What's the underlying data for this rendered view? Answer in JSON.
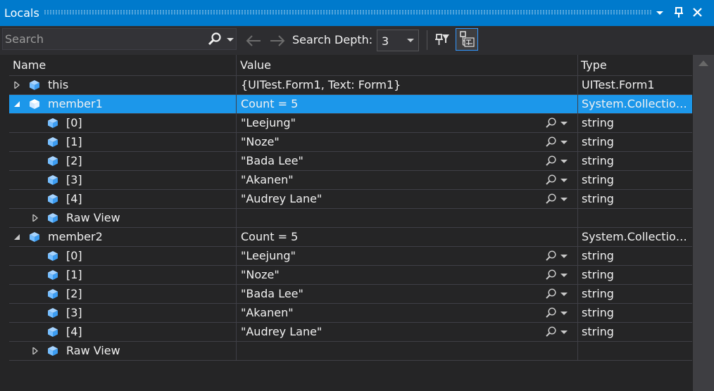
{
  "window": {
    "title": "Locals"
  },
  "toolbar": {
    "search_placeholder": "Search",
    "depth_label": "Search Depth:",
    "depth_value": "3"
  },
  "columns": {
    "name": "Name",
    "value": "Value",
    "type": "Type"
  },
  "rows": [
    {
      "level": 0,
      "expander": "collapsed",
      "icon": "cube",
      "name": "this",
      "value": "{UITest.Form1, Text: Form1}",
      "type": "UITest.Form1",
      "selected": false,
      "magnifier": false
    },
    {
      "level": 0,
      "expander": "expanded",
      "icon": "cube",
      "name": "member1",
      "value": "Count = 5",
      "type": "System.Collection…",
      "selected": true,
      "magnifier": false
    },
    {
      "level": 1,
      "expander": "none",
      "icon": "cube",
      "name": "[0]",
      "value": "\"Leejung\"",
      "type": "string",
      "selected": false,
      "magnifier": true
    },
    {
      "level": 1,
      "expander": "none",
      "icon": "cube",
      "name": "[1]",
      "value": "\"Noze\"",
      "type": "string",
      "selected": false,
      "magnifier": true
    },
    {
      "level": 1,
      "expander": "none",
      "icon": "cube",
      "name": "[2]",
      "value": "\"Bada Lee\"",
      "type": "string",
      "selected": false,
      "magnifier": true
    },
    {
      "level": 1,
      "expander": "none",
      "icon": "cube",
      "name": "[3]",
      "value": "\"Akanen\"",
      "type": "string",
      "selected": false,
      "magnifier": true
    },
    {
      "level": 1,
      "expander": "none",
      "icon": "cube",
      "name": "[4]",
      "value": "\"Audrey Lane\"",
      "type": "string",
      "selected": false,
      "magnifier": true
    },
    {
      "level": 1,
      "expander": "collapsed",
      "icon": "cube",
      "name": "Raw View",
      "value": "",
      "type": "",
      "selected": false,
      "magnifier": false
    },
    {
      "level": 0,
      "expander": "expanded",
      "icon": "cube",
      "name": "member2",
      "value": "Count = 5",
      "type": "System.Collection…",
      "selected": false,
      "magnifier": false
    },
    {
      "level": 1,
      "expander": "none",
      "icon": "cube",
      "name": "[0]",
      "value": "\"Leejung\"",
      "type": "string",
      "selected": false,
      "magnifier": true
    },
    {
      "level": 1,
      "expander": "none",
      "icon": "cube",
      "name": "[1]",
      "value": "\"Noze\"",
      "type": "string",
      "selected": false,
      "magnifier": true
    },
    {
      "level": 1,
      "expander": "none",
      "icon": "cube",
      "name": "[2]",
      "value": "\"Bada Lee\"",
      "type": "string",
      "selected": false,
      "magnifier": true
    },
    {
      "level": 1,
      "expander": "none",
      "icon": "cube",
      "name": "[3]",
      "value": "\"Akanen\"",
      "type": "string",
      "selected": false,
      "magnifier": true
    },
    {
      "level": 1,
      "expander": "none",
      "icon": "cube",
      "name": "[4]",
      "value": "\"Audrey Lane\"",
      "type": "string",
      "selected": false,
      "magnifier": true
    },
    {
      "level": 1,
      "expander": "collapsed",
      "icon": "cube",
      "name": "Raw View",
      "value": "",
      "type": "",
      "selected": false,
      "magnifier": false
    }
  ],
  "colors": {
    "accent": "#007acc",
    "selection": "#1c97ea",
    "background": "#252526",
    "toolbar": "#2d2d30",
    "text": "#f1f1f1",
    "icon_blue": "#75beff"
  }
}
